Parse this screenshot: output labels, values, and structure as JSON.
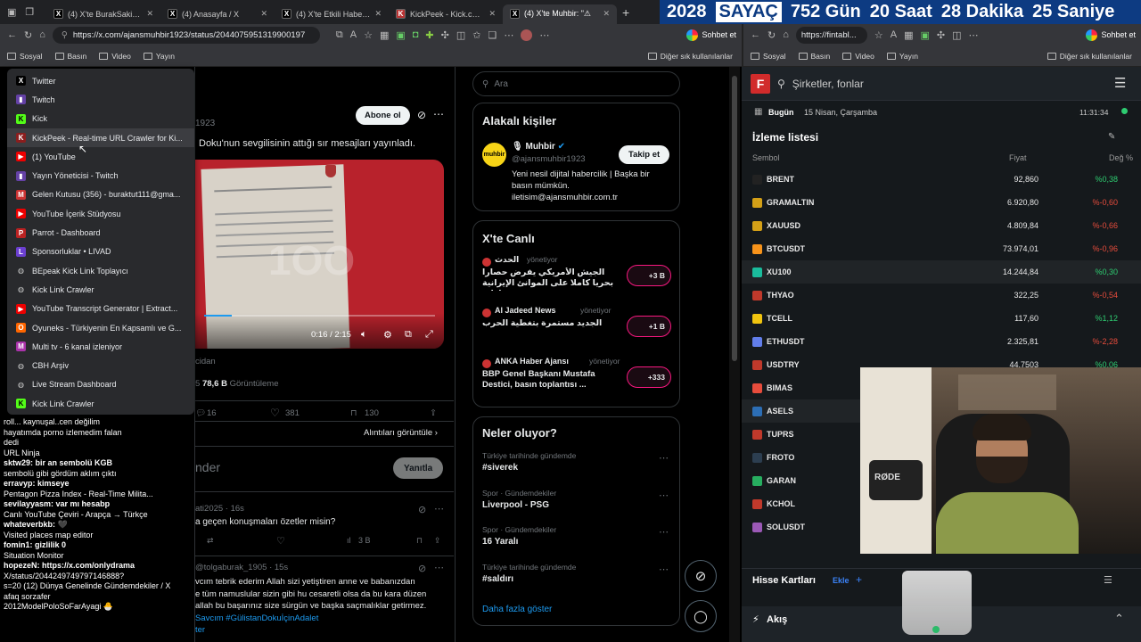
{
  "browser_tabs": [
    {
      "label": "(4) X'te BurakSakinOl: \"G",
      "icon": "x"
    },
    {
      "label": "(4) Anasayfa / X",
      "icon": "x"
    },
    {
      "label": "(4) X'te Etkili Haber Yeni",
      "icon": "x"
    },
    {
      "label": "KickPeek - Kick.com için",
      "icon": "kickpeek"
    },
    {
      "label": "(4) X'te Muhbir: \"⚠",
      "icon": "x",
      "active": true
    }
  ],
  "countdown": {
    "year": "2028",
    "label": "SAYAÇ",
    "days": "752 Gün",
    "hours": "20 Saat",
    "minutes": "28 Dakika",
    "seconds": "25 Saniye"
  },
  "left_browser": {
    "url": "https://x.com/ajansmuhbir1923/status/2044075951319900197",
    "chat_button": "Sohbet et",
    "bookmarks": [
      "Sosyal",
      "Basın",
      "Video",
      "Yayın"
    ],
    "other_bookmarks": "Diğer sık kullanılanlar"
  },
  "right_browser": {
    "url": "https://fintabl...",
    "chat_button": "Sohbet et",
    "bookmarks": [
      "Sosyal",
      "Basın",
      "Video",
      "Yayın"
    ],
    "other_bookmarks": "Diğer sık kullanılanlar"
  },
  "bookmark_menu": [
    {
      "label": "Twitter",
      "icon": "x-icon"
    },
    {
      "label": "Twitch",
      "icon": "twitch-icon"
    },
    {
      "label": "Kick",
      "icon": "kick-icon"
    },
    {
      "label": "KickPeek - Real-time URL Crawler for Ki...",
      "icon": "kickpeek-icon",
      "hover": true
    },
    {
      "label": "(1) YouTube",
      "icon": "youtube-icon"
    },
    {
      "label": "Yayın Yöneticisi - Twitch",
      "icon": "twitch-icon"
    },
    {
      "label": "Gelen Kutusu (356) - buraktut111@gma...",
      "icon": "gmail-icon"
    },
    {
      "label": "YouTube İçerik Stüdyosu",
      "icon": "youtube-icon"
    },
    {
      "label": "Parrot - Dashboard",
      "icon": "parrot-icon"
    },
    {
      "label": "Sponsorluklar • LIVAD",
      "icon": "livad-icon"
    },
    {
      "label": "BEpeak Kick Link Toplayıcı",
      "icon": "globe-icon"
    },
    {
      "label": "Kick Link Crawler",
      "icon": "globe-icon"
    },
    {
      "label": "YouTube Transcript Generator | Extract...",
      "icon": "youtube-icon"
    },
    {
      "label": "Oyuneks - Türkiyenin En Kapsamlı ve G...",
      "icon": "oyuneks-icon"
    },
    {
      "label": "Multi tv - 6 kanal izleniyor",
      "icon": "multitv-icon"
    },
    {
      "label": "CBH Arşiv",
      "icon": "globe-icon"
    },
    {
      "label": "Live Stream Dashboard",
      "icon": "globe-icon"
    },
    {
      "label": "Kick Link Crawler",
      "icon": "kick-icon"
    }
  ],
  "chat_overlay": [
    "roll... kaynuşal..cen değilim",
    "hayatımda porno izlemedim falan",
    "dedi",
    "URL Ninja",
    "sktw29: bir an sembolü KGB",
    "sembolü gibi gördüm aklım çıktı",
    "erravyp: kimseye",
    "Pentagon Pizza Index - Real-Time Milita...",
    "sevilayyasm: var mı hesabp",
    "Canlı YouTube Çeviri - Arapça → Türkçe",
    "whateverbkb: 🖤",
    "Visited places map editor",
    "fomin1: gizlilik 0",
    "Situation Monitor",
    "hopezeN: https://x.com/onlydrama",
    "X/status/2044249749797146888?",
    "s=20  (12) Dünya Genelinde Gündemdekiler / X",
    "afaq sorzafer",
    "2012ModelPoloSoFarAyagi 🐣"
  ],
  "tweet": {
    "header_date": "1923",
    "subscribe_label": "Abone ol",
    "text": "Doku'nun sevgilisinin attığı sır mesajları yayınladı.",
    "video_time": "0:16 / 2:15",
    "source_text": "cidan",
    "views_value": "78,6 B",
    "views_label": "Görüntüleme",
    "replies": "16",
    "likes": "381",
    "bookmarks": "130",
    "quotes_link": "Alıntıları görüntüle",
    "reply_placeholder": "nder",
    "reply_button": "Yanıtla"
  },
  "replies": [
    {
      "author": "ati2025 · 16s",
      "text": "a geçen konuşmaları özetler misin?",
      "views": "3 B"
    },
    {
      "author": "@tolgaburak_1905 · 15s",
      "text_lines": [
        "vcım tebrik ederim Allah sizi yetiştiren anne ve babanızdan",
        "e tüm namuslular sizin gibi hu cesaretli olsa da bu kara düzen",
        "allah bu başarınız size sürgün ve başka saçmalıklar getirmez.",
        "Savcım #GülistanDokuİçinAdalet"
      ],
      "tail": "ter"
    }
  ],
  "search_placeholder": "Ara",
  "related_people": {
    "title": "Alakalı kişiler",
    "name": "Muhbir",
    "handle": "@ajansmuhbir1923",
    "bio": "Yeni nesil dijital habercilik | Başka bir basın mümkün. iletisim@ajansmuhbir.com.tr",
    "follow_label": "Takip et",
    "avatar_text": "muhbir"
  },
  "live": {
    "title": "X'te Canlı",
    "items": [
      {
        "source": "الحدث",
        "role": "yönetiyor",
        "text": "الجيش الأمريكي يفرض حصارا بحريا كاملا على الموانئ الإيرانية وغارات ...",
        "count": "+3 B"
      },
      {
        "source": "Al Jadeed News",
        "role": "yönetiyor",
        "text": "الجديد مستمرة بتغطية الحرب",
        "count": "+1 B"
      },
      {
        "source": "ANKA Haber Ajansı",
        "role": "yönetiyor",
        "text": "BBP Genel Başkanı Mustafa Destici, basın toplantısı ...",
        "count": "+333"
      }
    ]
  },
  "trends": {
    "title": "Neler oluyor?",
    "items": [
      {
        "context": "Türkiye tarihinde gündemde",
        "name": "#siverek"
      },
      {
        "context": "Spor · Gündemdekiler",
        "name": "Liverpool - PSG"
      },
      {
        "context": "Spor · Gündemdekiler",
        "name": "16 Yaralı"
      },
      {
        "context": "Türkiye tarihinde gündemde",
        "name": "#saldırı"
      }
    ],
    "more": "Daha fazla göster"
  },
  "finance": {
    "search_placeholder": "Şirketler, fonlar",
    "today_label": "Bugün",
    "date": "15 Nisan, Çarşamba",
    "time": "11:31:34",
    "watchlist_title": "İzleme listesi",
    "col_symbol": "Sembol",
    "col_price": "Fiyat",
    "col_change": "Değ %",
    "rows": [
      {
        "symbol": "BRENT",
        "price": "92,860",
        "change": "%0,38",
        "dir": "pos",
        "color": "#222"
      },
      {
        "symbol": "GRAMALTIN",
        "price": "6.920,80",
        "change": "%-0,60",
        "dir": "neg",
        "color": "#d4a017"
      },
      {
        "symbol": "XAUUSD",
        "price": "4.809,84",
        "change": "%-0,66",
        "dir": "neg",
        "color": "#d4a017"
      },
      {
        "symbol": "BTCUSDT",
        "price": "73.974,01",
        "change": "%-0,96",
        "dir": "neg",
        "color": "#f7931a"
      },
      {
        "symbol": "XU100",
        "price": "14.244,84",
        "change": "%0,30",
        "dir": "pos",
        "color": "#1abc9c"
      },
      {
        "symbol": "THYAO",
        "price": "322,25",
        "change": "%-0,54",
        "dir": "neg",
        "color": "#c0392b"
      },
      {
        "symbol": "TCELL",
        "price": "117,60",
        "change": "%1,12",
        "dir": "pos",
        "color": "#f1c40f"
      },
      {
        "symbol": "ETHUSDT",
        "price": "2.325,81",
        "change": "%-2,28",
        "dir": "neg",
        "color": "#627eea"
      },
      {
        "symbol": "USDTRY",
        "price": "44,7503",
        "change": "%0,06",
        "dir": "pos",
        "color": "#c0392b"
      },
      {
        "symbol": "BIMAS",
        "price": "",
        "change": "",
        "dir": "pos",
        "color": "#e74c3c"
      },
      {
        "symbol": "ASELS",
        "price": "",
        "change": "",
        "dir": "pos",
        "color": "#2c6eb5"
      },
      {
        "symbol": "TUPRS",
        "price": "",
        "change": "",
        "dir": "pos",
        "color": "#c0392b"
      },
      {
        "symbol": "FROTO",
        "price": "",
        "change": "",
        "dir": "pos",
        "color": "#2c3e50"
      },
      {
        "symbol": "GARAN",
        "price": "",
        "change": "",
        "dir": "pos",
        "color": "#27ae60"
      },
      {
        "symbol": "KCHOL",
        "price": "",
        "change": "",
        "dir": "pos",
        "color": "#c0392b"
      },
      {
        "symbol": "SOLUSDT",
        "price": "",
        "change": "",
        "dir": "pos",
        "color": "#9b59b6"
      }
    ],
    "stock_cards_title": "Hisse Kartları",
    "add_label": "Ekle",
    "flow_label": "Akış"
  },
  "webcam": {
    "mic_brand": "RØDE"
  }
}
